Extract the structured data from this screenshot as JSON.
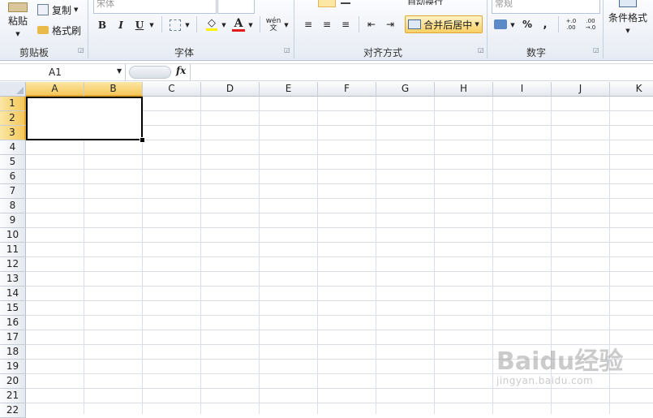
{
  "ribbon": {
    "clipboard": {
      "label": "剪贴板",
      "paste": "粘贴",
      "copy": "复制",
      "format_painter": "格式刷"
    },
    "font": {
      "label": "字体",
      "name_value": "宋体",
      "bold": "B",
      "italic": "I",
      "underline": "U",
      "font_color_letter": "A",
      "phonetic": "wén 文"
    },
    "alignment": {
      "label": "对齐方式",
      "wrap_text": "自动换行",
      "merge_center": "合并后居中"
    },
    "number": {
      "label": "数字",
      "format_value": "常规",
      "percent": "%",
      "comma": ",",
      "inc_decimal": "+.0 .00",
      "dec_decimal": ".00 →.0"
    },
    "styles": {
      "conditional_format": "条件格式"
    }
  },
  "formula_bar": {
    "name_box": "A1",
    "fx": "fx",
    "value": ""
  },
  "grid": {
    "columns": [
      "A",
      "B",
      "C",
      "D",
      "E",
      "F",
      "G",
      "H",
      "I",
      "J",
      "K"
    ],
    "selected_columns": [
      "A",
      "B"
    ],
    "rows": [
      "1",
      "2",
      "3",
      "4",
      "5",
      "6",
      "7",
      "8",
      "9",
      "10",
      "11",
      "12",
      "13",
      "14",
      "15",
      "16",
      "17",
      "18",
      "19",
      "20",
      "21",
      "22"
    ],
    "selected_rows": [
      "1",
      "2",
      "3"
    ],
    "selection_range": "A1:B3"
  },
  "watermark": {
    "logo": "Baidu经验",
    "url": "jingyan.baidu.com"
  },
  "colors": {
    "accent": "#f5c85a",
    "font_color": "#e41b1b",
    "ribbon_border": "#b6c3d6"
  }
}
